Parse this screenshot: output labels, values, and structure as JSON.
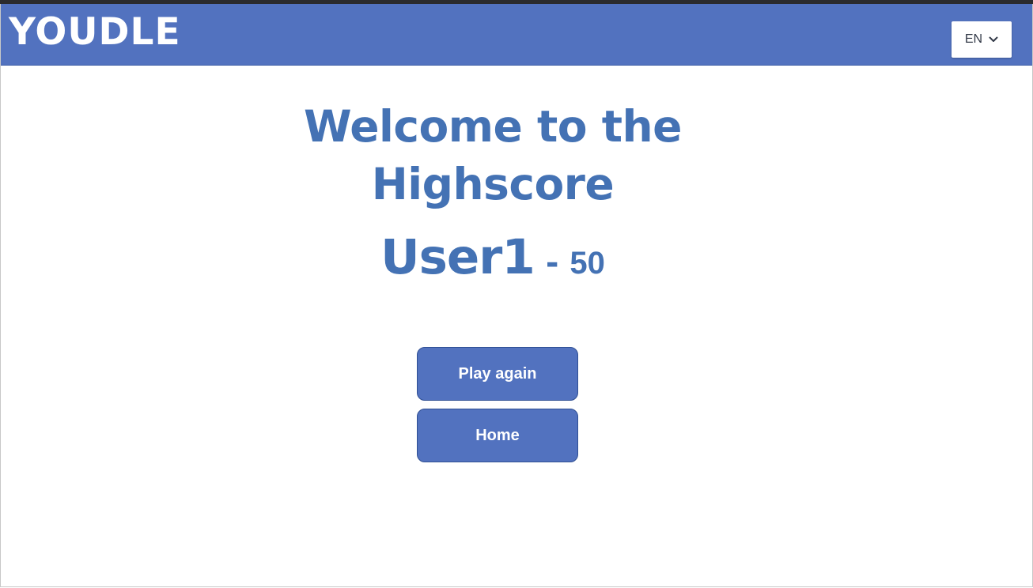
{
  "header": {
    "logo": "YOUDLE",
    "language": {
      "selected": "EN",
      "icon": "chevron-down-icon"
    }
  },
  "main": {
    "title": "Welcome to the Highscore",
    "score": {
      "user": "User1",
      "separator": "-",
      "value": "50"
    }
  },
  "buttons": {
    "play_again": "Play again",
    "home": "Home"
  },
  "colors": {
    "brand": "#5272bf",
    "heading": "#4472b4",
    "background": "#ffffff"
  }
}
